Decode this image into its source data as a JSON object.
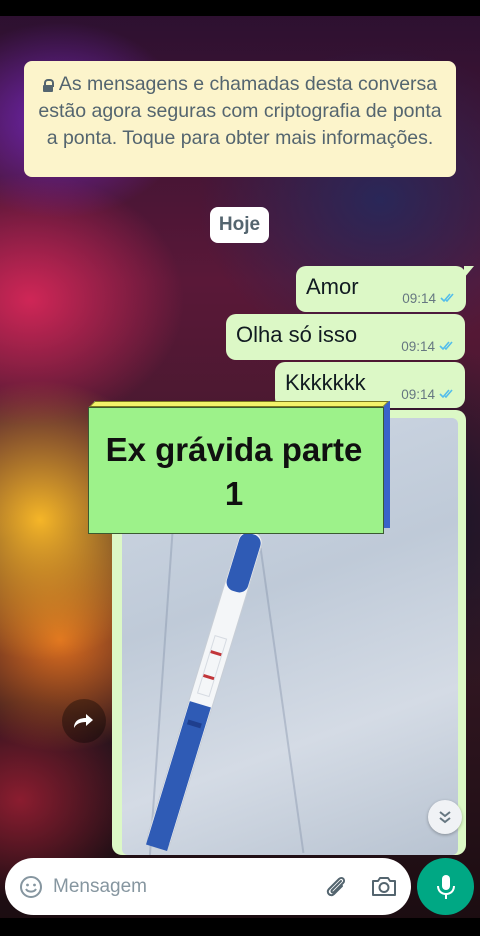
{
  "encryption_notice": {
    "text": "As mensagens e chamadas desta conversa estão agora seguras com criptografia de ponta a ponta. Toque para obter mais informações."
  },
  "date_chip": "Hoje",
  "messages": [
    {
      "text": "Amor",
      "time": "09:14",
      "status": "read"
    },
    {
      "text": "Olha só isso",
      "time": "09:14",
      "status": "read"
    },
    {
      "text": "Kkkkkkk",
      "time": "09:14",
      "status": "read"
    }
  ],
  "overlay_title": {
    "line1": "Ex grávida parte",
    "line2": "1"
  },
  "input": {
    "placeholder": "Mensagem"
  },
  "icons": {
    "emoji": "emoji-icon",
    "attach": "paperclip-icon",
    "camera": "camera-icon",
    "mic": "mic-icon",
    "forward": "forward-icon",
    "scroll_down": "double-chevron-down-icon"
  },
  "colors": {
    "outgoing_bubble": "#dcf8c6",
    "read_ticks": "#53bdeb",
    "mic_button": "#00a884",
    "notice_bg": "#fcf4cb"
  }
}
